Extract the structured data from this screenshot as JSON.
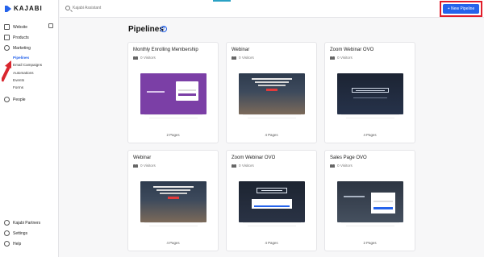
{
  "brand": {
    "name": "KAJABI"
  },
  "topbar": {
    "search_placeholder": "Kajabi Assistant",
    "new_pipeline_label": "+ New Pipeline"
  },
  "sidebar": {
    "items": [
      {
        "label": "Website",
        "icon": "monitor-icon"
      },
      {
        "label": "Products",
        "icon": "tag-icon"
      },
      {
        "label": "Marketing",
        "icon": "megaphone-icon"
      },
      {
        "label": "People",
        "icon": "person-icon"
      }
    ],
    "marketing_sub": [
      "Pipelines",
      "Email Campaigns",
      "Automations",
      "Events",
      "Forms"
    ],
    "bottom": [
      {
        "label": "Kajabi Partners",
        "icon": "partners-icon"
      },
      {
        "label": "Settings",
        "icon": "gear-icon"
      },
      {
        "label": "Help",
        "icon": "help-icon"
      }
    ]
  },
  "main": {
    "title": "Pipelines",
    "cards": [
      {
        "title": "Monthly Enrolling Membership",
        "visitors": "0 Visitors",
        "pages": "2 Pages",
        "thumb": "purple"
      },
      {
        "title": "Webinar",
        "visitors": "0 Visitors",
        "pages": "4 Pages",
        "thumb": "photo"
      },
      {
        "title": "Zoom Webinar OVO",
        "visitors": "0 Visitors",
        "pages": "4 Pages",
        "thumb": "dark"
      },
      {
        "title": "Webinar",
        "visitors": "0 Visitors",
        "pages": "4 Pages",
        "thumb": "photo"
      },
      {
        "title": "Zoom Webinar OVO",
        "visitors": "0 Visitors",
        "pages": "4 Pages",
        "thumb": "webinar2"
      },
      {
        "title": "Sales Page OVO",
        "visitors": "0 Visitors",
        "pages": "2 Pages",
        "thumb": "sales"
      }
    ]
  },
  "colors": {
    "accent": "#2563eb",
    "highlight": "#e11d2a",
    "arrow": "#d9262e"
  }
}
